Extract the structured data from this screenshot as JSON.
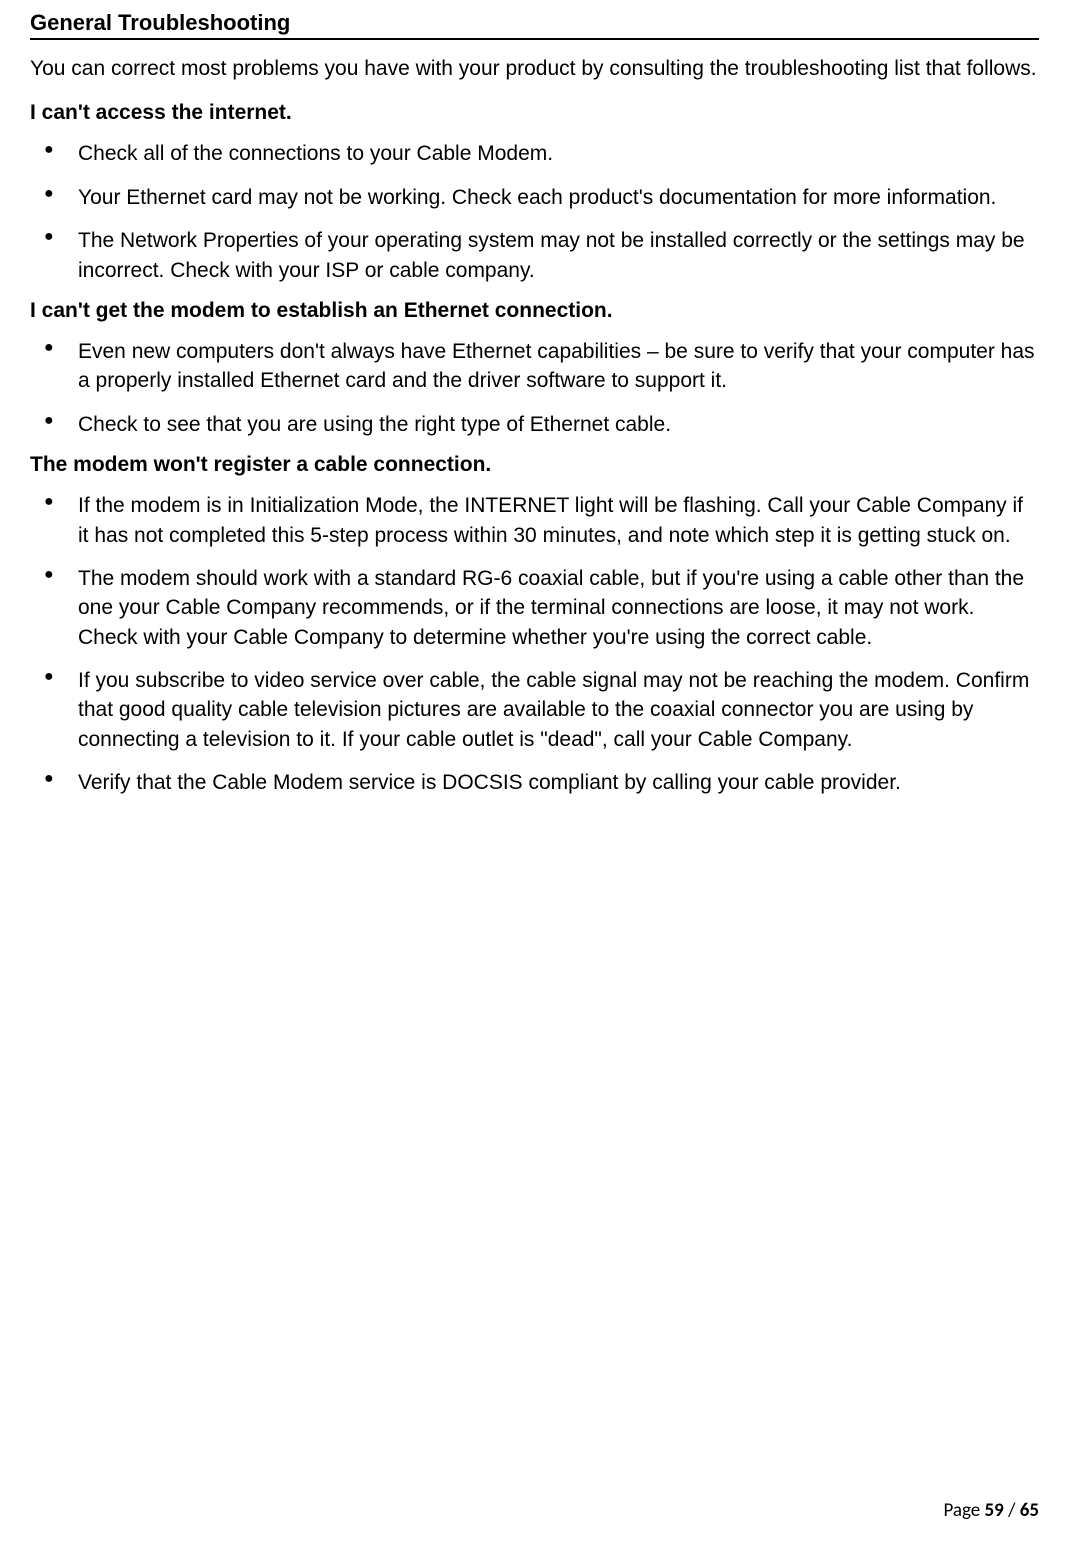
{
  "heading": "General Troubleshooting",
  "intro": "You can correct most problems you have with your product by consulting the troubleshooting list that follows.",
  "sections": [
    {
      "title": "I can't access the internet.",
      "items": [
        "Check all of the connections to your Cable Modem.",
        "Your Ethernet card may not be working. Check each product's documentation for more information.",
        "The Network Properties of your operating system may not be installed correctly or the settings may be incorrect. Check with your ISP or cable company."
      ]
    },
    {
      "title": "I can't get the modem to establish an Ethernet connection.",
      "items": [
        "Even new computers don't always have Ethernet capabilities – be sure to verify that your computer has a properly installed Ethernet card and the driver software to support it.",
        "Check to see that you are using the right type of Ethernet cable."
      ]
    },
    {
      "title": "The modem won't register a cable connection.",
      "items": [
        "If the modem is in Initialization Mode, the INTERNET light will be flashing. Call your Cable Company if it has not completed this 5-step process within 30 minutes, and note which step it is getting stuck on.",
        "The modem should work with a standard RG-6 coaxial cable, but if you're using a cable other than the one your Cable Company recommends, or if the terminal connections are loose, it may not work. Check with your Cable Company to determine whether you're using the correct cable.",
        "If you subscribe to video service over cable, the cable signal may not be reaching the modem. Confirm that good quality cable television pictures are available to the coaxial connector you are using by connecting a television to it. If your cable outlet is \"dead\", call your Cable Company.",
        "Verify that the Cable Modem service is DOCSIS compliant by calling your cable provider."
      ]
    }
  ],
  "footer": {
    "label": "Page ",
    "current": "59",
    "sep": " / ",
    "total": "65"
  }
}
